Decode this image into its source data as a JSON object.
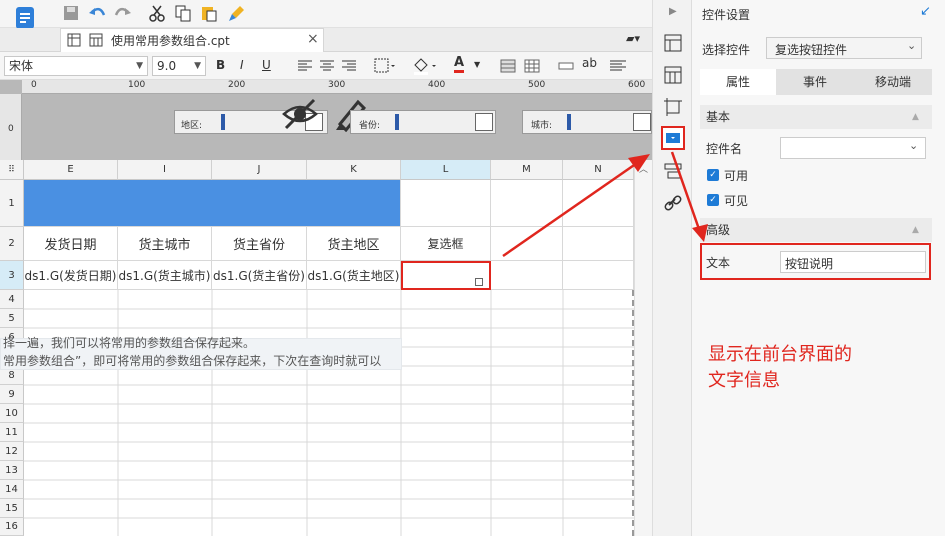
{
  "toolbar": {
    "icons": [
      "app-logo-icon",
      "save-icon",
      "undo-icon",
      "redo-icon",
      "cut-icon",
      "copy-icon",
      "paste-icon",
      "format-painter-icon"
    ]
  },
  "tab": {
    "title": "使用常用参数组合.cpt",
    "close": "×"
  },
  "format": {
    "font": "宋体",
    "size": "9.0",
    "bold": "B",
    "italic": "I",
    "underline": "U",
    "font_color_letter": "A",
    "text_icon": "ab"
  },
  "ruler": {
    "ticks": [
      "0",
      "100",
      "200",
      "300",
      "400",
      "500",
      "600"
    ],
    "vtick": "0"
  },
  "params": [
    {
      "label": "地区:"
    },
    {
      "label": "省份:"
    },
    {
      "label": "城市:"
    }
  ],
  "grid": {
    "columns": [
      "E",
      "I",
      "J",
      "K",
      "L",
      "M",
      "N"
    ],
    "rows": [
      "1",
      "2",
      "3",
      "4",
      "5",
      "6",
      "7",
      "8",
      "9",
      "10",
      "11",
      "12",
      "13",
      "14",
      "15",
      "16"
    ],
    "headers": [
      "发货日期",
      "货主城市",
      "货主省份",
      "货主地区",
      "复选框"
    ],
    "formulas": [
      "ds1.G(发货日期)",
      "ds1.G(货主城市)",
      "ds1.G(货主省份)",
      "ds1.G(货主地区)"
    ],
    "note_line1": "择一遍，我们可以将常用的参数组合保存起来。",
    "note_line2": "常用参数组合”，即可将常用的参数组合保存起来，下次在查询时就可以"
  },
  "panel": {
    "title": "控件设置",
    "select_label": "选择控件",
    "select_value": "复选按钮控件",
    "tabs": [
      "属性",
      "事件",
      "移动端"
    ],
    "basic": "基本",
    "name_label": "控件名",
    "name_value": "",
    "enabled": "可用",
    "visible": "可见",
    "advanced": "高级",
    "text_label": "文本",
    "text_value": "按钮说明"
  },
  "annotation": {
    "line1": "显示在前台界面的",
    "line2": "文字信息"
  },
  "colors": {
    "header_blue": "#4a90e2",
    "annotation_red": "#e0261e",
    "checkbox_blue": "#1e7bd6",
    "selected_col": "#d6ecf7"
  }
}
